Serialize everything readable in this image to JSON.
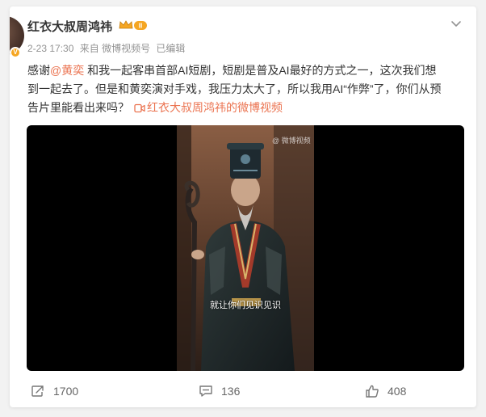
{
  "post": {
    "username": "红衣大叔周鸿祎",
    "member_badge_text": "II",
    "meta": {
      "date": "2-23 17:30",
      "source": "来自 微博视频号",
      "edited": "已编辑"
    },
    "text": {
      "part1": "感谢",
      "mention": "@黄奕",
      "part2": " 和我一起客串首部AI短剧，短剧是普及AI最好的方式之一，这次我们想到一起去了。但是和黄奕演对手戏，我压力太大了，所以我用AI“作弊”了，你们从预告片里能看出来吗？",
      "video_link": "红衣大叔周鸿祎的微博视频"
    },
    "video": {
      "watermark": "@ 微博视频",
      "subtitle": "就让你们见识见识"
    },
    "actions": {
      "repost_count": "1700",
      "comment_count": "136",
      "like_count": "408"
    }
  },
  "colors": {
    "accent": "#eb7350",
    "text": "#333333",
    "meta": "#939393",
    "badge": "#f5a623"
  },
  "icons": {
    "more": "chevron-down-icon",
    "repost": "repost-icon",
    "comment": "comment-icon",
    "like": "thumbs-up-icon",
    "video_link": "video-link-icon",
    "member": "crown-icon"
  }
}
